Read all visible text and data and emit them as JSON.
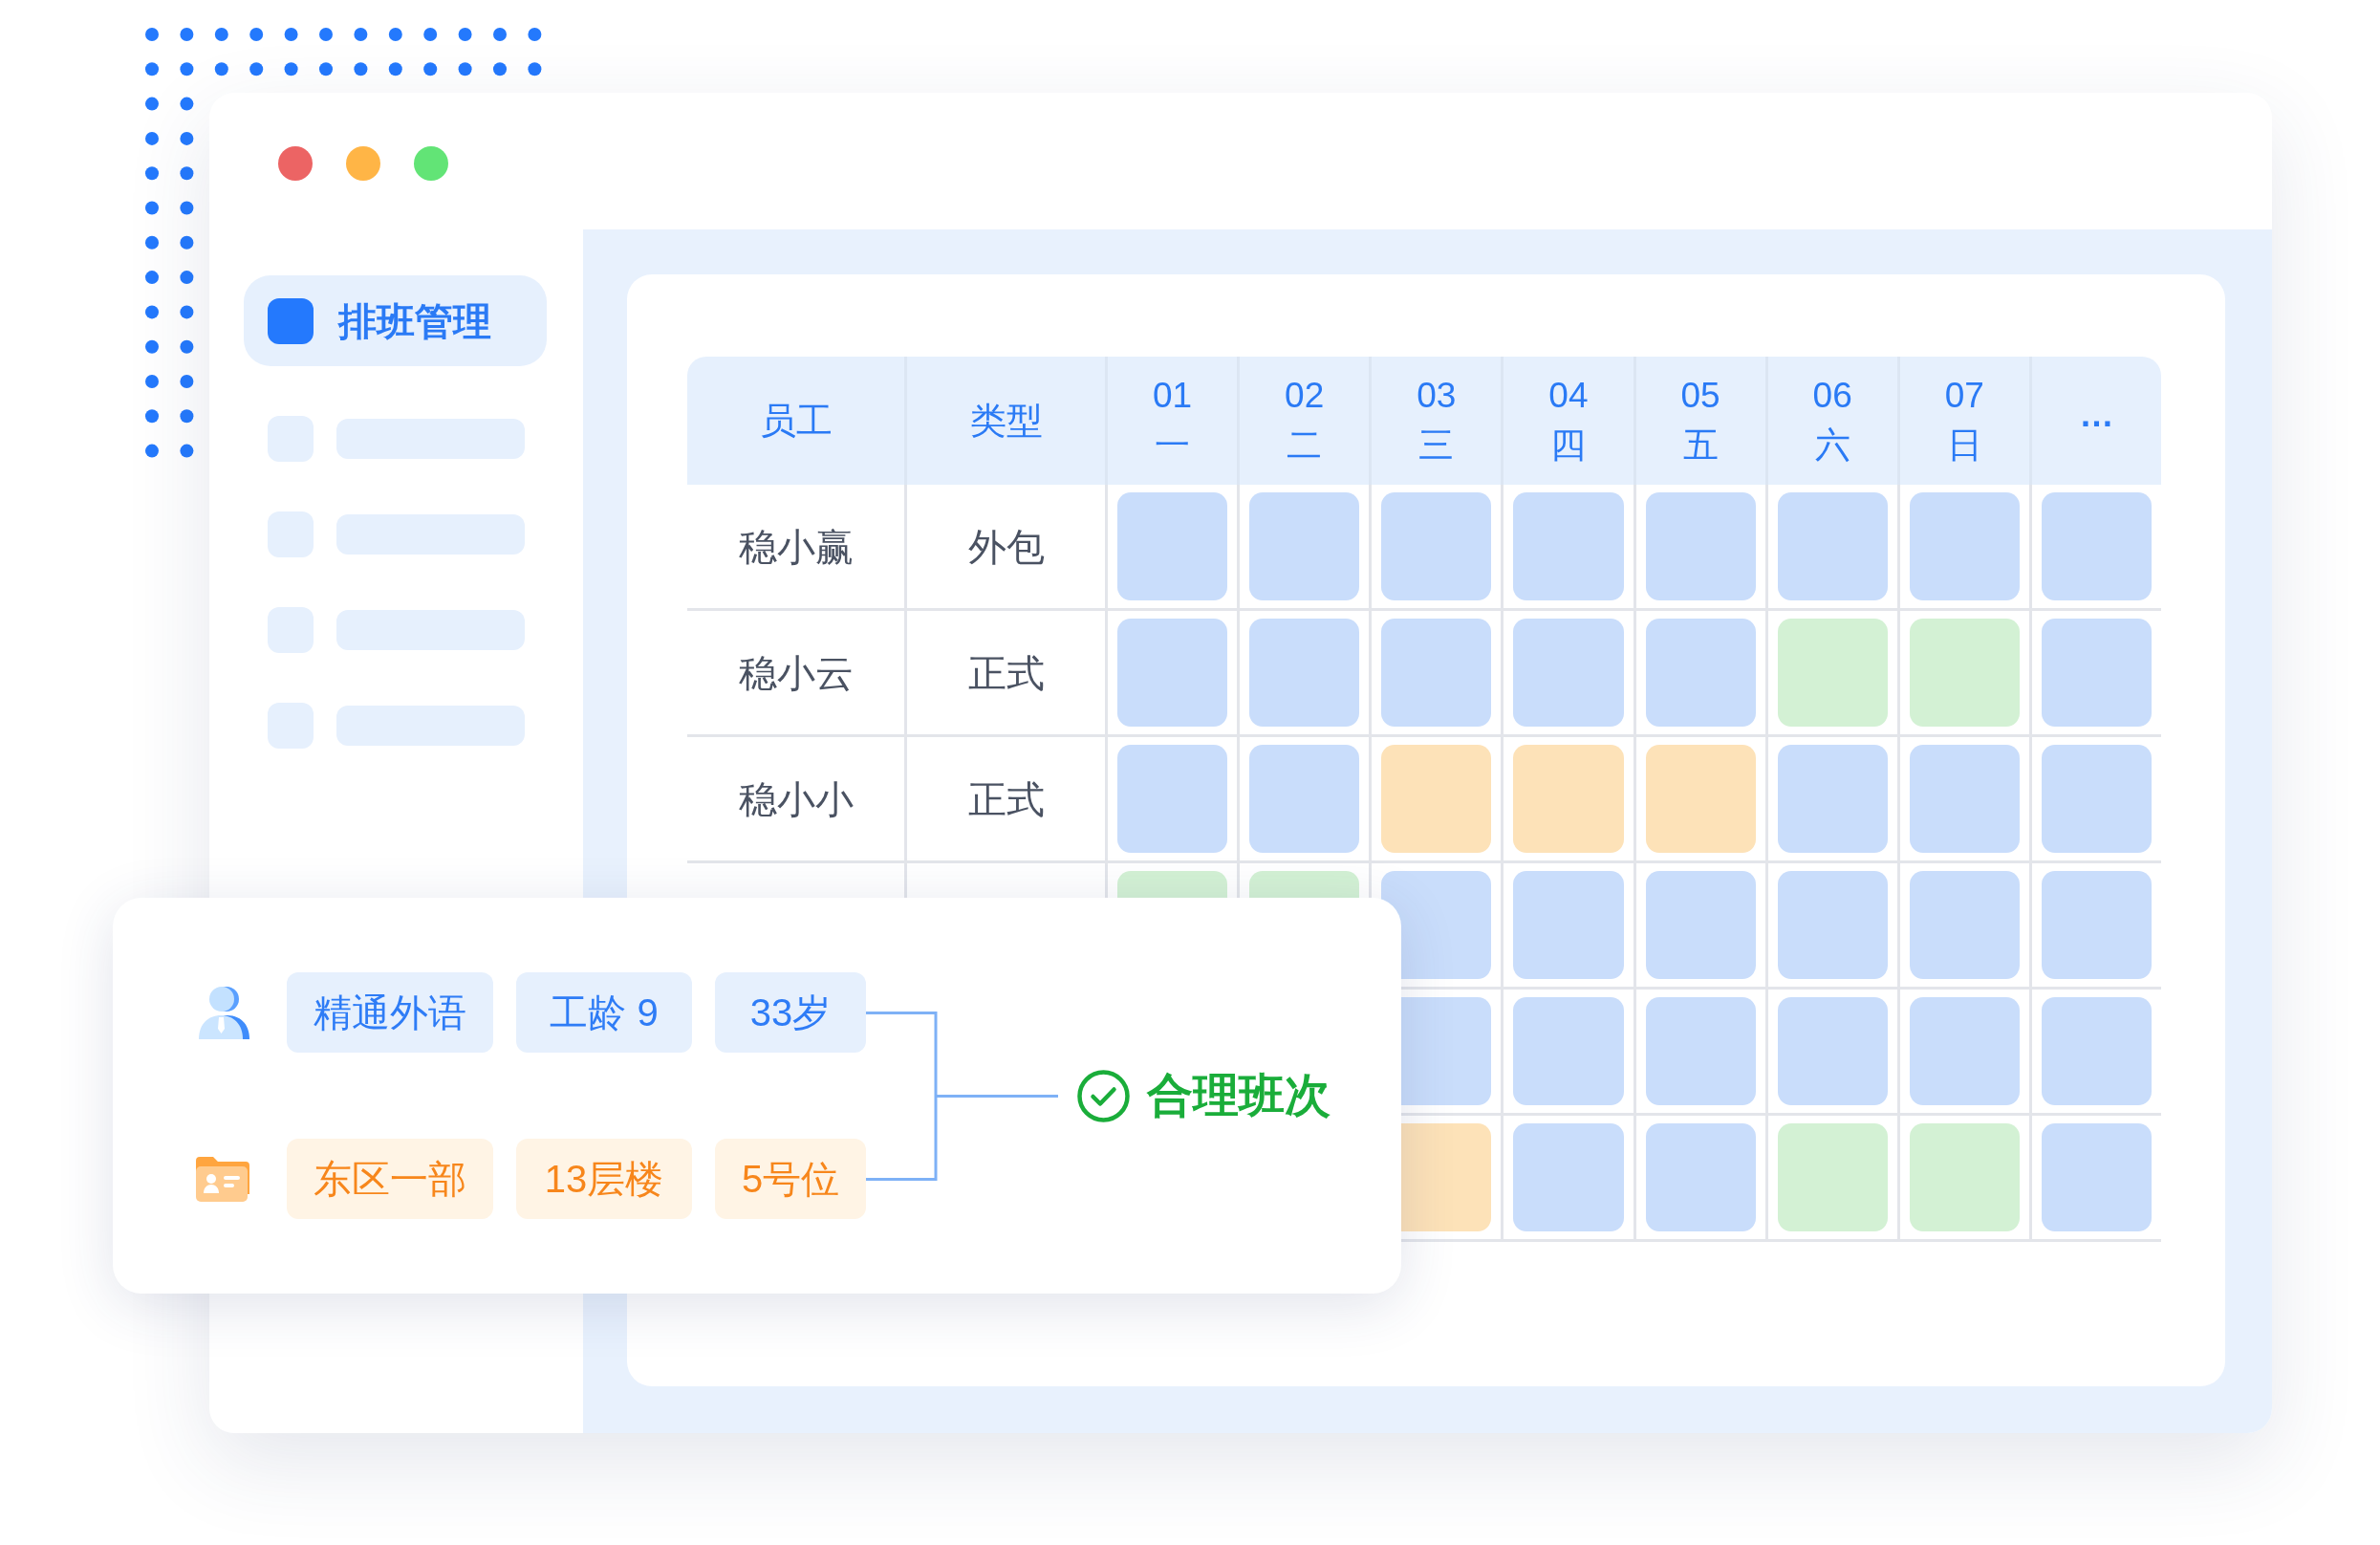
{
  "window": {
    "controls": [
      {
        "color": "#ec6464"
      },
      {
        "color": "#ffb546"
      },
      {
        "color": "#62e476"
      }
    ]
  },
  "sidebar": {
    "items": [
      {
        "kind": "menu",
        "label": "排班管理",
        "selected": true
      },
      {
        "kind": "skeleton"
      },
      {
        "kind": "skeleton"
      },
      {
        "kind": "skeleton"
      },
      {
        "kind": "skeleton"
      }
    ]
  },
  "schedule": {
    "columns": [
      {
        "kind": "text",
        "label": "员工"
      },
      {
        "kind": "text",
        "label": "类型"
      },
      {
        "kind": "day",
        "date": "01",
        "weekday": "一"
      },
      {
        "kind": "day",
        "date": "02",
        "weekday": "二"
      },
      {
        "kind": "day",
        "date": "03",
        "weekday": "三"
      },
      {
        "kind": "day",
        "date": "04",
        "weekday": "四"
      },
      {
        "kind": "day",
        "date": "05",
        "weekday": "五"
      },
      {
        "kind": "day",
        "date": "06",
        "weekday": "六"
      },
      {
        "kind": "day",
        "date": "07",
        "weekday": "日"
      },
      {
        "kind": "more",
        "label": "…"
      }
    ],
    "rows": [
      {
        "employee": "稳小赢",
        "type": "外包",
        "shifts": [
          {
            "color": "#c9ddfb"
          },
          {
            "color": "#c9ddfb"
          },
          {
            "color": "#c9ddfb"
          },
          {
            "color": "#c9ddfb"
          },
          {
            "color": "#c9ddfb"
          },
          {
            "color": "#c9ddfb"
          },
          {
            "color": "#c9ddfb"
          },
          {
            "color": "#c9ddfb"
          }
        ]
      },
      {
        "employee": "稳小云",
        "type": "正式",
        "shifts": [
          {
            "color": "#c9ddfb"
          },
          {
            "color": "#c9ddfb"
          },
          {
            "color": "#c9ddfb"
          },
          {
            "color": "#c9ddfb"
          },
          {
            "color": "#c9ddfb"
          },
          {
            "color": "#d3f1d4"
          },
          {
            "color": "#d3f1d4"
          },
          {
            "color": "#c9ddfb"
          }
        ]
      },
      {
        "employee": "稳小小",
        "type": "正式",
        "shifts": [
          {
            "color": "#c9ddfb"
          },
          {
            "color": "#c9ddfb"
          },
          {
            "color": "#fde2b8"
          },
          {
            "color": "#fde2b8"
          },
          {
            "color": "#fde2b8"
          },
          {
            "color": "#c9ddfb"
          },
          {
            "color": "#c9ddfb"
          },
          {
            "color": "#c9ddfb"
          }
        ]
      },
      {
        "shifts": [
          {
            "color": "#d3f1d4"
          },
          {
            "color": "#d3f1d4"
          },
          {
            "color": "#c9ddfb"
          },
          {
            "color": "#c9ddfb"
          },
          {
            "color": "#c9ddfb"
          },
          {
            "color": "#c9ddfb"
          },
          {
            "color": "#c9ddfb"
          },
          {
            "color": "#c9ddfb"
          }
        ]
      },
      {
        "shifts": [
          {
            "color": "#c9ddfb"
          },
          {
            "color": "#c9ddfb"
          },
          {
            "color": "#c9ddfb"
          },
          {
            "color": "#c9ddfb"
          },
          {
            "color": "#c9ddfb"
          },
          {
            "color": "#c9ddfb"
          }
        ]
      },
      {
        "shifts": [
          {
            "color": "#fde2b8"
          },
          {
            "color": "#c9ddfb"
          },
          {
            "color": "#c9ddfb"
          },
          {
            "color": "#d3f1d4"
          },
          {
            "color": "#d3f1d4"
          },
          {
            "color": "#c9ddfb"
          }
        ]
      }
    ]
  },
  "info_card": {
    "attribute_groups": [
      {
        "kind": "person",
        "tags": [
          "精通外语",
          "工龄 9",
          "33岁"
        ]
      },
      {
        "kind": "location",
        "tags": [
          "东区一部",
          "13层楼",
          "5号位"
        ]
      }
    ],
    "result": "合理班次"
  }
}
